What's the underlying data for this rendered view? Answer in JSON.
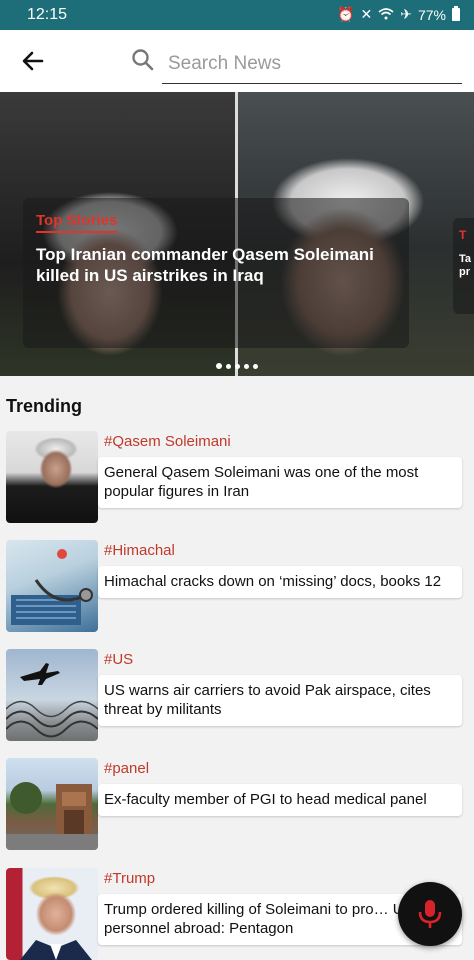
{
  "status_bar": {
    "time": "12:15",
    "battery": "77%",
    "icons": [
      "alarm-icon",
      "mute-icon",
      "wifi-icon",
      "airplane-icon",
      "battery-icon"
    ]
  },
  "header": {
    "search_placeholder": "Search News"
  },
  "hero": {
    "tag": "Top Stories",
    "title": "Top Iranian commander Qasem Soleimani killed in US airstrikes in Iraq",
    "next_title_peek": "Ta\npr",
    "slide_count": 5,
    "active_slide": 1
  },
  "trending": {
    "title": "Trending",
    "items": [
      {
        "tag": "#Qasem Soleimani",
        "headline": "General Qasem Soleimani was one of the most popular figures in Iran"
      },
      {
        "tag": "#Himachal",
        "headline": "Himachal cracks down on ‘missing’ docs, books 12"
      },
      {
        "tag": "#US",
        "headline": "US warns air carriers to avoid Pak airspace, cites threat by militants"
      },
      {
        "tag": "#panel",
        "headline": "Ex-faculty member of PGI to head medical panel"
      },
      {
        "tag": "#Trump",
        "headline": "Trump ordered killing of Soleimani to pro… US personnel abroad: Pentagon"
      }
    ]
  },
  "colors": {
    "status_bar": "#1d6e78",
    "accent_red": "#e0342c",
    "tag_red": "#c0392b",
    "mic_button": "#111111",
    "mic_icon": "#d8232a"
  }
}
